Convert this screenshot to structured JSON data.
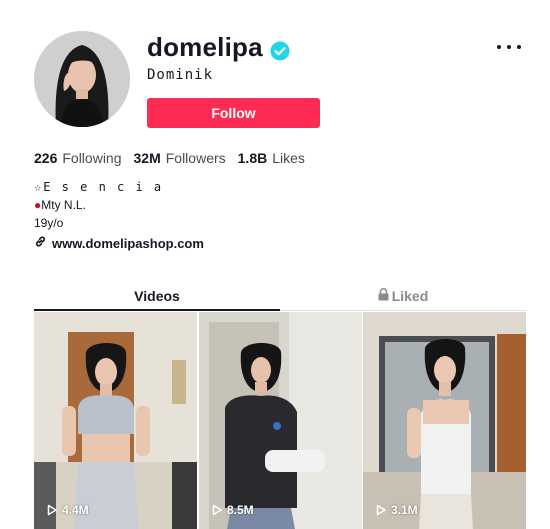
{
  "profile": {
    "username": "domelipa",
    "nickname": "Dominik",
    "verified": true,
    "follow_label": "Follow",
    "more_icon": "ellipsis-icon"
  },
  "stats": {
    "following_count": "226",
    "following_label": "Following",
    "followers_count": "32M",
    "followers_label": "Followers",
    "likes_count": "1.8B",
    "likes_label": "Likes"
  },
  "bio": {
    "line1": "☆E s e n c i a",
    "line2": "Mty N.L.",
    "line3": "19y/o",
    "link": "www.domelipashop.com"
  },
  "tabs": {
    "videos": "Videos",
    "liked": "Liked"
  },
  "videos": [
    {
      "views": "4.4M"
    },
    {
      "views": "8.5M"
    },
    {
      "views": "3.1M"
    }
  ],
  "colors": {
    "accent": "#fe2c55",
    "verified": "#20d5ec",
    "text": "#161823",
    "muted": "#8a8b91"
  }
}
